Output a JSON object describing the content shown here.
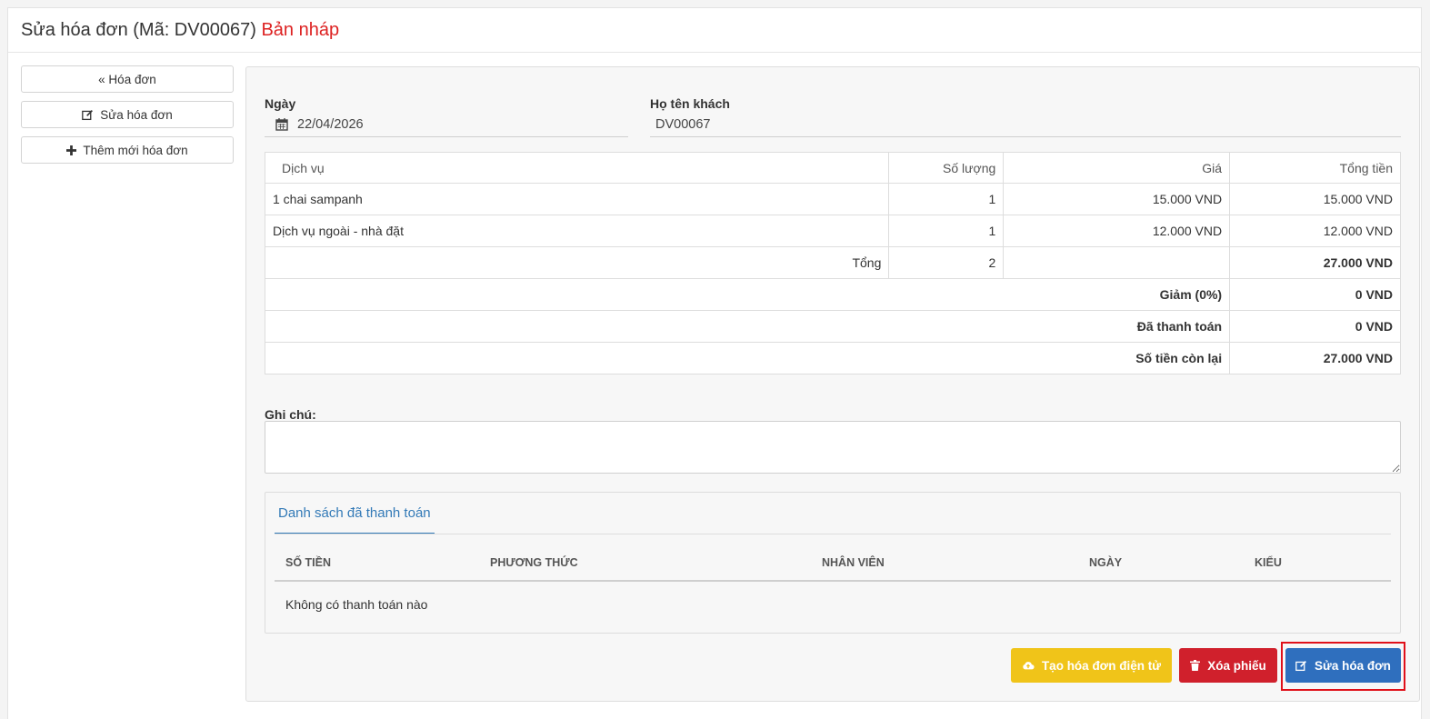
{
  "header": {
    "title": "Sửa hóa đơn (Mã: DV00067)",
    "status": "Bản nháp"
  },
  "sidebar": {
    "items": [
      {
        "label": "« Hóa đơn",
        "icon": "none"
      },
      {
        "label": "Sửa hóa đơn",
        "icon": "edit-icon"
      },
      {
        "label": "Thêm mới hóa đơn",
        "icon": "plus-icon"
      }
    ]
  },
  "form": {
    "date_label": "Ngày",
    "date_value": "22/04/2026",
    "customer_label": "Họ tên khách",
    "customer_value": "DV00067"
  },
  "table": {
    "headers": [
      "Dịch vụ",
      "Số lượng",
      "Giá",
      "Tổng tiền"
    ],
    "rows": [
      {
        "service": "1 chai sampanh",
        "qty": "1",
        "price": "15.000 VND",
        "total": "15.000 VND"
      },
      {
        "service": "Dịch vụ ngoài - nhà đặt",
        "qty": "1",
        "price": "12.000 VND",
        "total": "12.000 VND"
      }
    ],
    "sum": {
      "label": "Tổng",
      "qty": "2",
      "total": "27.000 VND"
    },
    "discount": {
      "label": "Giảm (0%)",
      "value": "0 VND"
    },
    "paid": {
      "label": "Đã thanh toán",
      "value": "0 VND"
    },
    "remaining": {
      "label": "Số tiền còn lại",
      "value": "27.000 VND"
    }
  },
  "note": {
    "label": "Ghi chú:",
    "value": ""
  },
  "payments": {
    "tab_label": "Danh sách đã thanh toán",
    "columns": [
      "SỐ TIỀN",
      "PHƯƠNG THỨC",
      "NHÂN VIÊN",
      "NGÀY",
      "KIỂU"
    ],
    "empty_text": "Không có thanh toán nào"
  },
  "actions": {
    "einvoice_label": "Tạo hóa đơn điện tử",
    "delete_label": "Xóa phiếu",
    "edit_label": "Sửa hóa đơn"
  },
  "colors": {
    "status": "#dd2222",
    "primary": "#2f6fbe",
    "warning": "#f0c419",
    "danger": "#d0202c",
    "highlight": "#e0101a"
  }
}
